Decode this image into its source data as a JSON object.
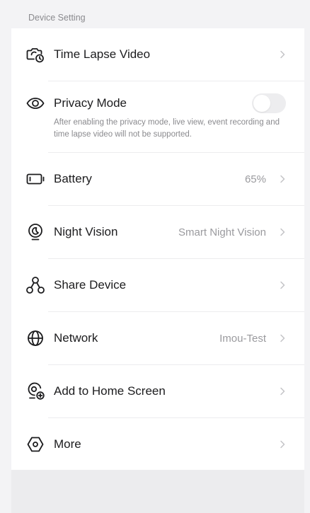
{
  "section": {
    "title": "Device Setting"
  },
  "items": [
    {
      "key": "time-lapse",
      "label": "Time Lapse Video",
      "value": "",
      "icon": "camera-clock-icon"
    },
    {
      "key": "privacy",
      "label": "Privacy Mode",
      "description": "After enabling the privacy mode, live view, event recording and time lapse video will not be supported.",
      "toggle_on": false,
      "icon": "eye-icon"
    },
    {
      "key": "battery",
      "label": "Battery",
      "value": "65%",
      "icon": "battery-icon"
    },
    {
      "key": "night-vision",
      "label": "Night Vision",
      "value": "Smart Night Vision",
      "icon": "night-vision-icon"
    },
    {
      "key": "share",
      "label": "Share Device",
      "value": "",
      "icon": "share-users-icon"
    },
    {
      "key": "network",
      "label": "Network",
      "value": "Imou-Test",
      "icon": "globe-icon"
    },
    {
      "key": "home-screen",
      "label": "Add to Home Screen",
      "value": "",
      "icon": "add-home-icon"
    },
    {
      "key": "more",
      "label": "More",
      "value": "",
      "icon": "more-hexagon-icon"
    }
  ],
  "colors": {
    "background": "#f3f3f5",
    "card": "#ffffff",
    "text": "#1c1c1e",
    "secondary_text": "#9a9a9e",
    "toggle_off": "#ededef"
  }
}
